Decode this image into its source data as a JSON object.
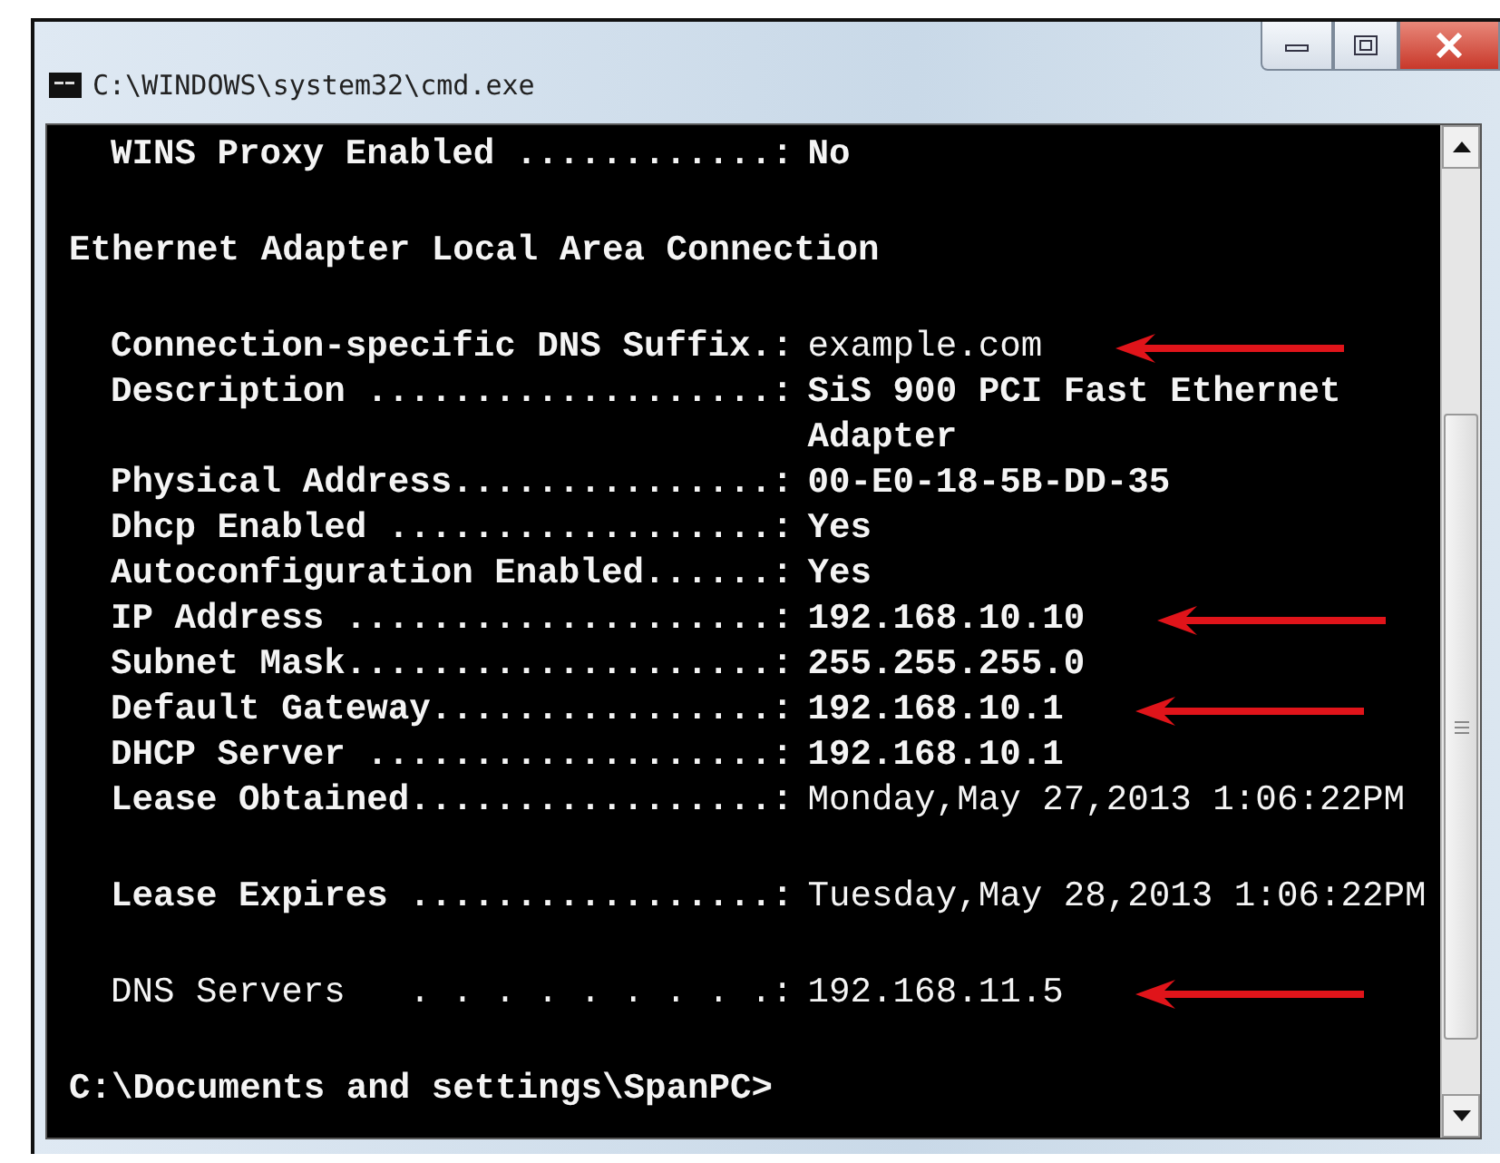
{
  "window": {
    "title": "C:\\WINDOWS\\system32\\cmd.exe"
  },
  "lines": [
    {
      "kind": "pair",
      "label": "WINS Proxy Enabled ............:",
      "value": "No",
      "label_bold": true,
      "value_bold": true,
      "arrow": false,
      "gap_before": false
    },
    {
      "kind": "heading",
      "text": "Ethernet Adapter Local Area Connection"
    },
    {
      "kind": "pair",
      "label": "Connection-specific DNS Suffix.:",
      "value": "example.com",
      "label_bold": true,
      "value_bold": false,
      "arrow": true,
      "gap_before": true
    },
    {
      "kind": "pair",
      "label": "Description ...................:",
      "value": "SiS 900 PCI Fast Ethernet Adapter",
      "label_bold": true,
      "value_bold": true,
      "arrow": false,
      "gap_before": false
    },
    {
      "kind": "pair",
      "label": "Physical Address...............:",
      "value": "00-E0-18-5B-DD-35",
      "label_bold": true,
      "value_bold": true,
      "arrow": false,
      "gap_before": false
    },
    {
      "kind": "pair",
      "label": "Dhcp Enabled ..................:",
      "value": "Yes",
      "label_bold": true,
      "value_bold": true,
      "arrow": false,
      "gap_before": false
    },
    {
      "kind": "pair",
      "label": "Autoconfiguration Enabled......:",
      "value": "Yes",
      "label_bold": true,
      "value_bold": true,
      "arrow": false,
      "gap_before": false
    },
    {
      "kind": "pair",
      "label": "IP Address ....................:",
      "value": "192.168.10.10",
      "label_bold": true,
      "value_bold": true,
      "arrow": true,
      "gap_before": false
    },
    {
      "kind": "pair",
      "label": "Subnet Mask....................:",
      "value": "255.255.255.0",
      "label_bold": true,
      "value_bold": true,
      "arrow": false,
      "gap_before": false
    },
    {
      "kind": "pair",
      "label": "Default Gateway................:",
      "value": "192.168.10.1",
      "label_bold": true,
      "value_bold": true,
      "arrow": true,
      "gap_before": false
    },
    {
      "kind": "pair",
      "label": "DHCP Server ...................:",
      "value": "192.168.10.1",
      "label_bold": true,
      "value_bold": true,
      "arrow": false,
      "gap_before": false
    },
    {
      "kind": "pair",
      "label": "Lease Obtained.................:",
      "value": "Monday,May 27,2013 1:06:22PM",
      "label_bold": true,
      "value_bold": false,
      "arrow": false,
      "gap_before": false
    },
    {
      "kind": "pair",
      "label": "Lease Expires .................:",
      "value": "Tuesday,May 28,2013 1:06:22PM",
      "label_bold": true,
      "value_bold": false,
      "arrow": false,
      "gap_before": true
    },
    {
      "kind": "pair",
      "label": "DNS Servers   . . . . . . . . .:",
      "value": "192.168.11.5",
      "label_bold": false,
      "value_bold": false,
      "arrow": true,
      "gap_before": true
    },
    {
      "kind": "prompt",
      "text": "C:\\Documents and settings\\SpanPC>",
      "gap_before": true
    }
  ]
}
